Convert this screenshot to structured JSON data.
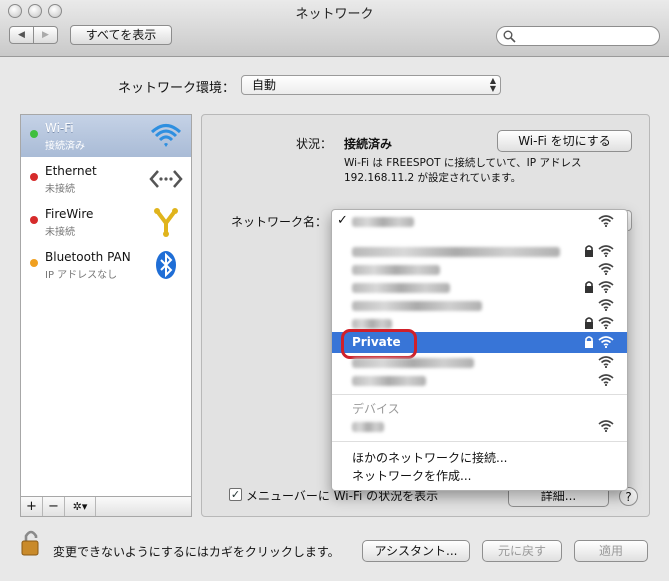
{
  "window": {
    "title": "ネットワーク"
  },
  "toolbar": {
    "back_label": "◀",
    "forward_label": "▶",
    "show_all": "すべてを表示",
    "search_placeholder": ""
  },
  "location": {
    "label": "ネットワーク環境：",
    "value": "自動"
  },
  "services": [
    {
      "name": "Wi-Fi",
      "status": "接続済み",
      "status_color": "#3fbf3f",
      "icon": "wifi-icon"
    },
    {
      "name": "Ethernet",
      "status": "未接続",
      "status_color": "#d62b2b",
      "icon": "ethernet-icon"
    },
    {
      "name": "FireWire",
      "status": "未接続",
      "status_color": "#d62b2b",
      "icon": "firewire-icon"
    },
    {
      "name": "Bluetooth PAN",
      "status": "IP アドレスなし",
      "status_color": "#f0a020",
      "icon": "bluetooth-icon"
    }
  ],
  "sidebar_footer": {
    "add": "+",
    "remove": "−",
    "gear": "✲▾"
  },
  "status": {
    "label": "状況：",
    "value": "接続済み",
    "toggle_button": "Wi-Fi を切にする",
    "description_line1": "Wi-Fi は FREESPOT に接続していて、IP アドレス",
    "description_line2": "192.168.11.2 が設定されています。"
  },
  "network_name": {
    "label": "ネットワーク名："
  },
  "menu": {
    "checkmark": "✓",
    "highlighted": "Private",
    "section_devices": "デバイス",
    "join_other": "ほかのネットワークに接続...",
    "create": "ネットワークを作成..."
  },
  "show_status": {
    "checked": true,
    "label": "メニューバーに Wi-Fi の状況を表示"
  },
  "buttons": {
    "advanced": "詳細...",
    "help": "?",
    "assist": "アシスタント...",
    "revert": "元に戻す",
    "apply": "適用"
  },
  "lock_hint": "変更できないようにするにはカギをクリックします。",
  "colors": {
    "highlight": "#3875d7",
    "annotation": "#d0202a"
  }
}
